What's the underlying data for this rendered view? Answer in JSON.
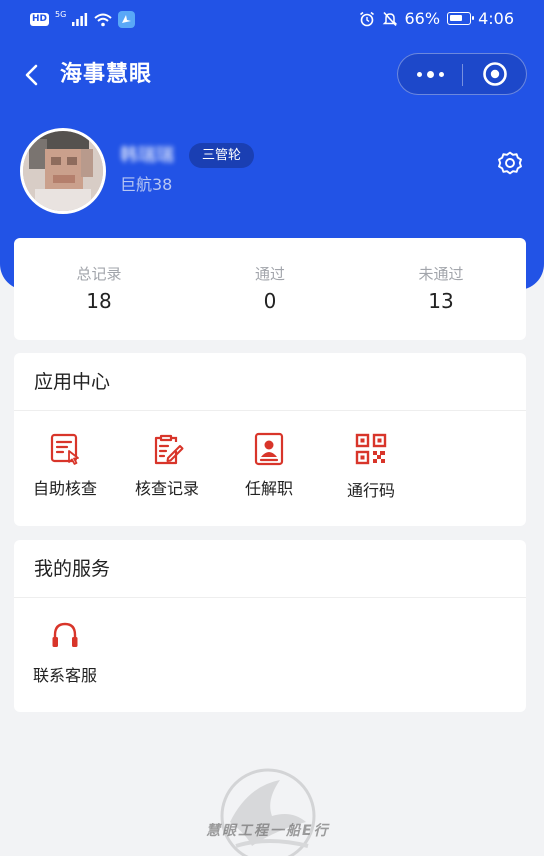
{
  "status_bar": {
    "hd": "HD",
    "network": "5G",
    "battery_percent": "66%",
    "time": "4:06"
  },
  "nav": {
    "title": "海事慧眼"
  },
  "profile": {
    "user_name": "韩瑞瑞",
    "role_badge": "三管轮",
    "ship_name": "巨航38"
  },
  "stats": [
    {
      "label": "总记录",
      "value": "18"
    },
    {
      "label": "通过",
      "value": "0"
    },
    {
      "label": "未通过",
      "value": "13"
    }
  ],
  "app_center": {
    "title": "应用中心",
    "items": [
      {
        "label": "自助核查",
        "icon": "self-check-icon"
      },
      {
        "label": "核查记录",
        "icon": "check-record-icon"
      },
      {
        "label": "任解职",
        "icon": "appointment-icon"
      },
      {
        "label": "通行码",
        "icon": "qr-code-icon"
      }
    ]
  },
  "my_services": {
    "title": "我的服务",
    "items": [
      {
        "label": "联系客服",
        "icon": "headset-icon"
      }
    ]
  },
  "watermark": {
    "text": "慧眼工程一船E行"
  },
  "colors": {
    "brand_blue": "#2253e6",
    "badge_blue": "#1a3fb3",
    "icon_red": "#d8352a",
    "page_bg": "#f2f3f5"
  }
}
